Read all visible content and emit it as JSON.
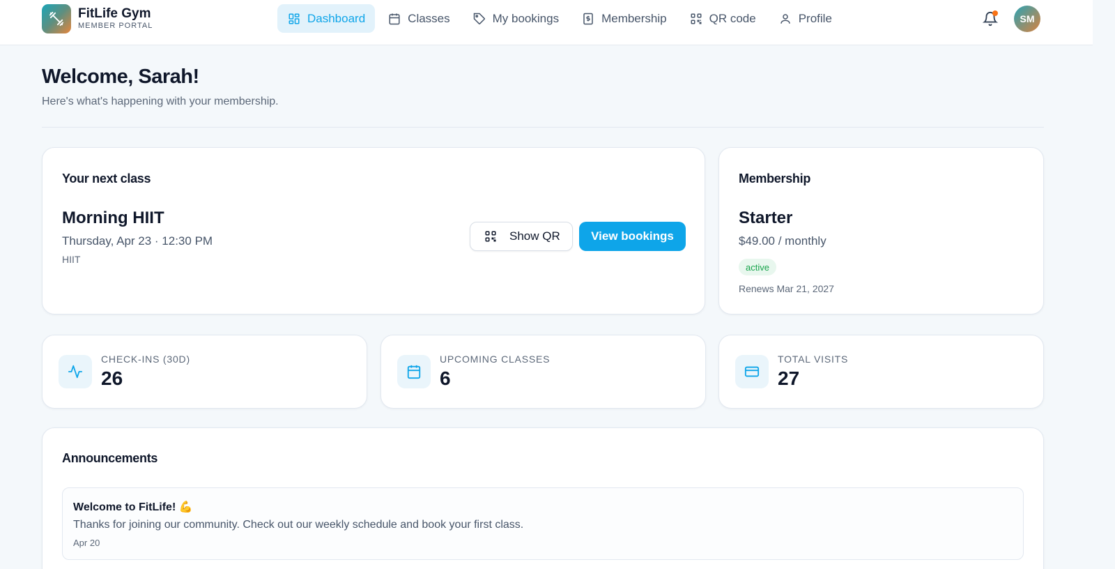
{
  "brand": {
    "name": "FitLife Gym",
    "subtitle": "MEMBER PORTAL"
  },
  "nav": {
    "items": [
      {
        "label": "Dashboard",
        "icon": "dashboard-icon",
        "active": true
      },
      {
        "label": "Classes",
        "icon": "calendar-icon",
        "active": false
      },
      {
        "label": "My bookings",
        "icon": "tag-icon",
        "active": false
      },
      {
        "label": "Membership",
        "icon": "dollar-receipt-icon",
        "active": false
      },
      {
        "label": "QR code",
        "icon": "qr-code-icon",
        "active": false
      },
      {
        "label": "Profile",
        "icon": "user-icon",
        "active": false
      }
    ],
    "avatar_initials": "SM"
  },
  "header": {
    "title": "Welcome, Sarah!",
    "subtitle": "Here's what's happening with your membership."
  },
  "next_class": {
    "heading": "Your next class",
    "name": "Morning HIIT",
    "when": "Thursday, Apr 23 · 12:30 PM",
    "type": "HIIT",
    "show_qr_label": "Show QR",
    "view_bookings_label": "View bookings"
  },
  "membership": {
    "heading": "Membership",
    "plan": "Starter",
    "price": "$49.00 / monthly",
    "status": "active",
    "renews": "Renews Mar 21, 2027"
  },
  "stats": [
    {
      "label": "CHECK-INS (30D)",
      "value": "26",
      "icon": "activity-icon"
    },
    {
      "label": "UPCOMING CLASSES",
      "value": "6",
      "icon": "calendar-icon"
    },
    {
      "label": "TOTAL VISITS",
      "value": "27",
      "icon": "credit-card-icon"
    }
  ],
  "announcements": {
    "heading": "Announcements",
    "items": [
      {
        "title": "Welcome to FitLife! 💪",
        "body": "Thanks for joining our community. Check out our weekly schedule and book your first class.",
        "date": "Apr 20"
      }
    ]
  },
  "colors": {
    "accent": "#0ea5e9",
    "nav_active_bg": "#e2f2fb",
    "status_active": "#16a34a",
    "notification_dot": "#f97316"
  }
}
